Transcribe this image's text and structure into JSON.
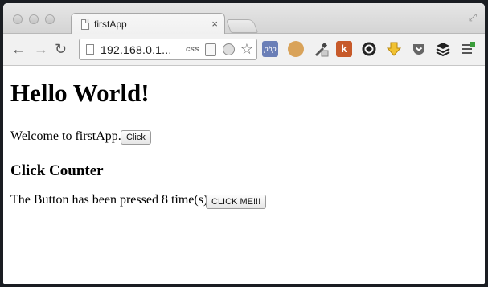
{
  "tab": {
    "title": "firstApp",
    "close": "×"
  },
  "toolbar": {
    "back": "←",
    "forward": "→",
    "reload": "↻",
    "url": "192.168.0.1...",
    "css_label": "css",
    "star": "☆",
    "php_label": "php",
    "k_label": "k"
  },
  "fullscreen": "⤢",
  "page": {
    "heading": "Hello World!",
    "welcome_text": "Welcome to firstApp.",
    "click_button": "Click",
    "counter_heading": "Click Counter",
    "counter_text": "The Button has been pressed 8 time(s)",
    "click_me_button": "CLICK ME!!!"
  }
}
